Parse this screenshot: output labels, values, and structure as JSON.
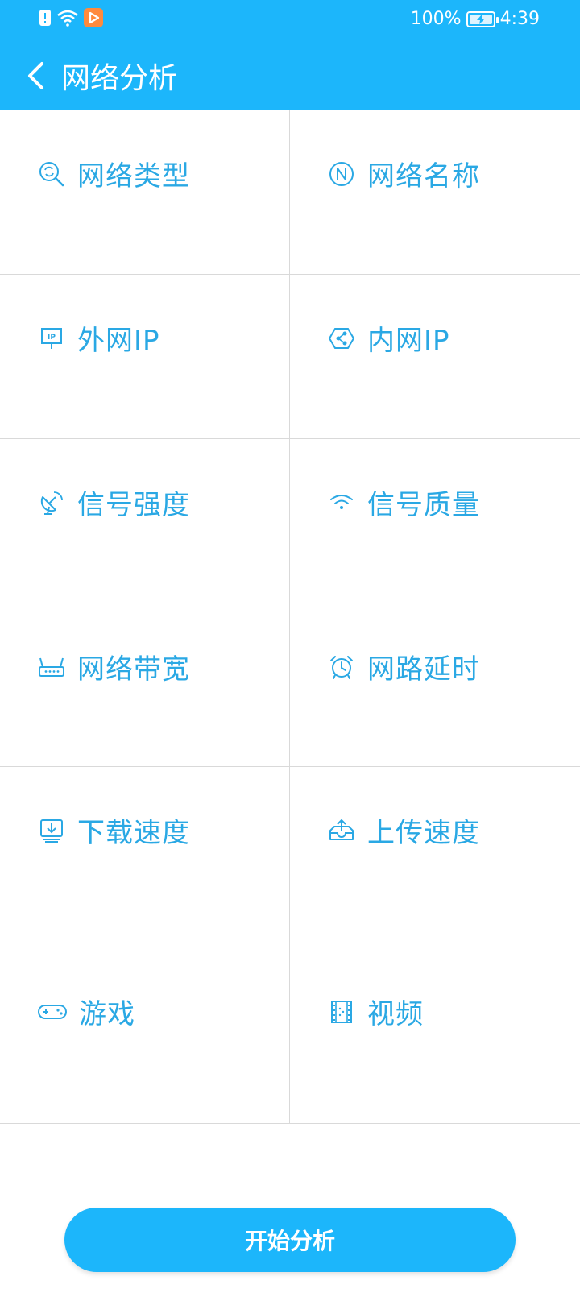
{
  "status_bar": {
    "battery": "100%",
    "time": "4:39"
  },
  "header": {
    "title": "网络分析"
  },
  "grid": {
    "items": [
      {
        "label": "网络类型",
        "icon": "search-refresh-icon"
      },
      {
        "label": "网络名称",
        "icon": "n-circle-icon"
      },
      {
        "label": "外网IP",
        "icon": "ip-sign-icon"
      },
      {
        "label": "内网IP",
        "icon": "share-hexagon-icon"
      },
      {
        "label": "信号强度",
        "icon": "satellite-dish-icon"
      },
      {
        "label": "信号质量",
        "icon": "wifi-icon"
      },
      {
        "label": "网络带宽",
        "icon": "router-icon"
      },
      {
        "label": "网路延时",
        "icon": "alarm-clock-icon"
      },
      {
        "label": "下载速度",
        "icon": "download-icon"
      },
      {
        "label": "上传速度",
        "icon": "upload-icon"
      },
      {
        "label": "游戏",
        "icon": "gamepad-icon"
      },
      {
        "label": "视频",
        "icon": "film-icon"
      }
    ]
  },
  "actions": {
    "start_label": "开始分析"
  },
  "colors": {
    "primary": "#1cb6fb",
    "label": "#2aa8e4",
    "divider": "#d9d9d9"
  }
}
